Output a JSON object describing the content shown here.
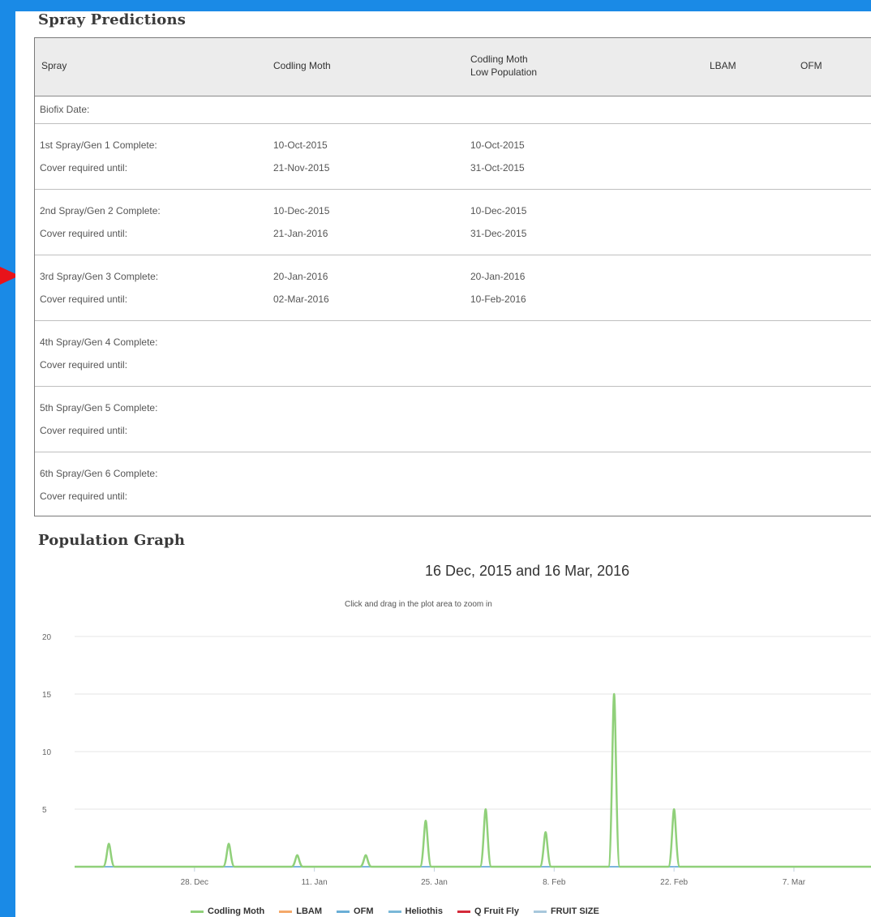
{
  "spray_title": "Spray Predictions",
  "table": {
    "headers": {
      "spray": "Spray",
      "codling": "Codling Moth",
      "codling_low_1": "Codling Moth",
      "codling_low_2": "Low Population",
      "lbam": "LBAM",
      "ofm": "OFM"
    },
    "biofix": "Biofix Date:",
    "rows": [
      {
        "label1": "1st Spray/Gen 1 Complete:",
        "label2": "Cover required until:",
        "cm1": "10-Oct-2015",
        "cm2": "21-Nov-2015",
        "low1": "10-Oct-2015",
        "low2": "31-Oct-2015"
      },
      {
        "label1": "2nd Spray/Gen 2 Complete:",
        "label2": "Cover required until:",
        "cm1": "10-Dec-2015",
        "cm2": "21-Jan-2016",
        "low1": "10-Dec-2015",
        "low2": "31-Dec-2015"
      },
      {
        "label1": "3rd Spray/Gen 3 Complete:",
        "label2": "Cover required until:",
        "cm1": "20-Jan-2016",
        "cm2": "02-Mar-2016",
        "low1": "20-Jan-2016",
        "low2": "10-Feb-2016"
      },
      {
        "label1": "4th Spray/Gen 4 Complete:",
        "label2": "Cover required until:",
        "cm1": "",
        "cm2": "",
        "low1": "",
        "low2": ""
      },
      {
        "label1": "5th Spray/Gen 5 Complete:",
        "label2": "Cover required until:",
        "cm1": "",
        "cm2": "",
        "low1": "",
        "low2": ""
      },
      {
        "label1": "6th Spray/Gen 6 Complete:",
        "label2": "Cover required until:",
        "cm1": "",
        "cm2": "",
        "low1": "",
        "low2": ""
      }
    ]
  },
  "graph_title": "Population Graph",
  "chart_data": {
    "type": "line",
    "title": "16 Dec, 2015 and 16 Mar, 2016",
    "subtitle": "Click and drag in the plot area to zoom in",
    "xlabel": "",
    "ylabel": "",
    "ylim": [
      0,
      20
    ],
    "yticks": [
      5,
      10,
      15,
      20
    ],
    "xtick_labels": [
      "28. Dec",
      "11. Jan",
      "25. Jan",
      "8. Feb",
      "22. Feb",
      "7. Mar"
    ],
    "grid": true,
    "legend_position": "bottom",
    "series": [
      {
        "name": "Codling Moth",
        "color": "#90d07a",
        "points": [
          [
            "2015-12-18",
            2
          ],
          [
            "2016-01-01",
            2
          ],
          [
            "2016-01-09",
            1
          ],
          [
            "2016-01-17",
            1
          ],
          [
            "2016-01-24",
            4
          ],
          [
            "2016-01-31",
            5
          ],
          [
            "2016-02-07",
            3
          ],
          [
            "2016-02-15",
            15
          ],
          [
            "2016-02-22",
            5
          ]
        ]
      },
      {
        "name": "LBAM",
        "color": "#f4a96a",
        "points": []
      },
      {
        "name": "OFM",
        "color": "#6aaed6",
        "points": []
      },
      {
        "name": "Heliothis",
        "color": "#7ab8d8",
        "points": []
      },
      {
        "name": "Q Fruit Fly",
        "color": "#d42a3a",
        "points": []
      },
      {
        "name": "FRUIT SIZE",
        "color": "#a8c8dc",
        "points": []
      }
    ]
  }
}
